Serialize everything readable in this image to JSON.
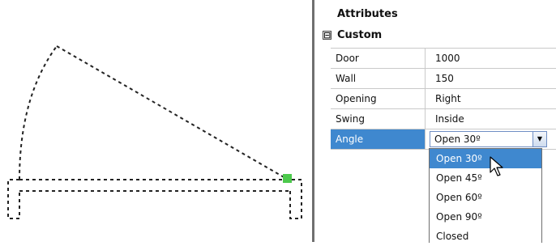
{
  "panel": {
    "header": "Attributes",
    "group": {
      "expander": "⊟",
      "label": "Custom"
    },
    "rows": [
      {
        "name": "Door",
        "value": "1000"
      },
      {
        "name": "Wall",
        "value": "150"
      },
      {
        "name": "Opening",
        "value": "Right"
      },
      {
        "name": "Swing",
        "value": "Inside"
      },
      {
        "name": "Angle",
        "value": "Open 30º"
      }
    ],
    "selected_row": "Angle",
    "dropdown_options": [
      "Open 30º",
      "Open 45º",
      "Open 60º",
      "Open 90º",
      "Closed"
    ],
    "highlighted_option": "Open 30º"
  },
  "colors": {
    "selection": "#3f88cf",
    "grip": "#4cc94c",
    "divider": "#6f6f6f"
  },
  "icons": {
    "expander": "minus-box",
    "combo_arrow": "chevron-down",
    "cursor": "arrow-pointer"
  }
}
